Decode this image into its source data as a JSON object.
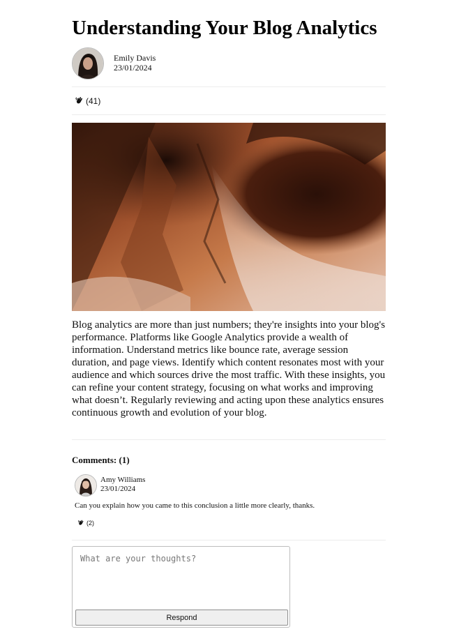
{
  "post": {
    "title": "Understanding Your Blog Analytics",
    "author": "Emily Davis",
    "date": "23/01/2024",
    "claps": "(41)",
    "hero_image": "abstract-rust-texture",
    "body": "Blog analytics are more than just numbers; they're insights into your blog's performance. Platforms like Google Analytics provide a wealth of information. Understand metrics like bounce rate, average session duration, and page views. Identify which content resonates most with your audience and which sources drive the most traffic. With these insights, you can refine your content strategy, focusing on what works and improving what doesn’t. Regularly reviewing and acting upon these analytics ensures continuous growth and evolution of your blog."
  },
  "comments": {
    "heading": "Comments: (1)",
    "items": [
      {
        "author": "Amy Williams",
        "date": "23/01/2024",
        "text": "Can you explain how you came to this conclusion a little more clearly, thanks.",
        "claps": "(2)"
      }
    ]
  },
  "respond": {
    "placeholder": "What are your thoughts?",
    "button_label": "Respond"
  },
  "icons": {
    "clap": "clap-icon",
    "avatar": "user-avatar"
  }
}
